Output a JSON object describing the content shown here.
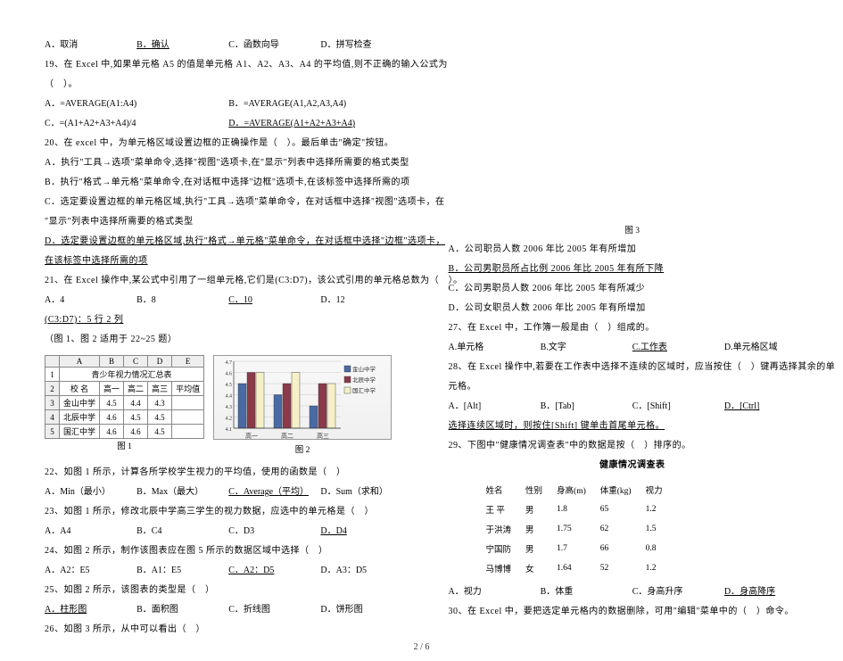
{
  "left": {
    "q18": {
      "a": "A．取消",
      "b": "B．确认",
      "c": "C．函数向导",
      "d": "D．拼写检查"
    },
    "q19": {
      "stem": "19、在 Excel 中,如果单元格 A5 的值是单元格 A1、A2、A3、A4 的平均值,则不正确的输入公式为",
      "stem2": "（　）。",
      "a": "A．=AVERAGE(A1:A4)",
      "b": "B．=AVERAGE(A1,A2,A3,A4)",
      "c": "C．=(A1+A2+A3+A4)/4",
      "d": "D．=AVERAGE(A1+A2+A3+A4)"
    },
    "q20": {
      "stem": "20、在 excel 中，为单元格区域设置边框的正确操作是（　）。最后单击\"确定\"按钮。",
      "a": "A．执行\"工具→选项\"菜单命令,选择\"视图\"选项卡,在\"显示\"列表中选择所需要的格式类型",
      "b": "B．执行\"格式→单元格\"菜单命令,在对话框中选择\"边框\"选项卡,在该标签中选择所需的项",
      "c": "C．选定要设置边框的单元格区域,执行\"工具→选项\"菜单命令，在对话框中选择\"视图\"选项卡，在",
      "c2": "\"显示\"列表中选择所需要的格式类型",
      "d": "D．选定要设置边框的单元格区域,执行\"格式→单元格\"菜单命令，在对话框中选择\"边框\"选项卡，",
      "d2": "在该标签中选择所需的项"
    },
    "q21": {
      "stem": "21、在 Excel 操作中,某公式中引用了一组单元格,它们是(C3:D7)，该公式引用的单元格总数为（　）。",
      "a": "A．4",
      "b": "B．8",
      "c": "C．10",
      "d": "D．12",
      "note": "(C3:D7)：5 行 2 列"
    },
    "figs_note": "（图 1、图 2 适用于 22~25 题）",
    "table": {
      "cols": [
        "",
        "A",
        "B",
        "C",
        "D",
        "E"
      ],
      "title": "青少年视力情况汇总表",
      "header": [
        "校 名",
        "高一",
        "高二",
        "高三",
        "平均值"
      ],
      "rows": [
        [
          "金山中学",
          "4.5",
          "4.4",
          "4.3",
          ""
        ],
        [
          "北辰中学",
          "4.6",
          "4.5",
          "4.5",
          ""
        ],
        [
          "国汇中学",
          "4.6",
          "4.6",
          "4.5",
          ""
        ]
      ]
    },
    "chart_data": {
      "type": "bar",
      "categories": [
        "高一",
        "高二",
        "高三"
      ],
      "series": [
        {
          "name": "金山中学",
          "values": [
            4.5,
            4.4,
            4.3
          ],
          "color": "#4a6aa5"
        },
        {
          "name": "北辰中学",
          "values": [
            4.6,
            4.5,
            4.5
          ],
          "color": "#8b3a4a"
        },
        {
          "name": "国汇中学",
          "values": [
            4.6,
            4.6,
            4.5
          ],
          "color": "#f5f0c8"
        }
      ],
      "ylim": [
        4.1,
        4.7
      ],
      "ticks": [
        4.1,
        4.2,
        4.3,
        4.4,
        4.5,
        4.6,
        4.7
      ]
    },
    "fig1": "图 1",
    "fig2": "图 2",
    "q22": {
      "stem": "22、如图 1 所示，计算各所学校学生视力的平均值，使用的函数是（　）",
      "a": "A．Min（最小）",
      "b": "B．Max（最大）",
      "c": "C．Average（平均）",
      "d": "D．Sum（求和）"
    },
    "q23": {
      "stem": "23、如图 1 所示，修改北辰中学高三学生的视力数据，应选中的单元格是（　）",
      "a": "A．A4",
      "b": "B．C4",
      "c": "C．D3",
      "d": "D．D4"
    },
    "q24": {
      "stem": "24、如图 2 所示，制作该图表应在图 5 所示的数据区域中选择（　）",
      "a": "A．A2：E5",
      "b": "B．A1：E5",
      "c": "C．A2：D5",
      "d": "D．A3：D5"
    },
    "q25": {
      "stem": "25、如图 2 所示，该图表的类型是（　）",
      "a": "A．柱形图",
      "b": "B．面积图",
      "c": "C．折线图",
      "d": "D．饼形图"
    },
    "q26": "26、如图 3 所示，从中可以看出（　）"
  },
  "right": {
    "fig3": "图 3",
    "q26opts": {
      "a": "A．公司职员人数 2006 年比 2005 年有所增加",
      "b": "B．公司男职员所占比例 2006 年比 2005 年有所下降",
      "c": "C．公司男职员人数 2006 年比 2005 年有所减少",
      "d": "D．公司女职员人数 2006 年比 2005 年有所增加"
    },
    "q27": {
      "stem": "27、在 Excel 中，工作簿一般是由（　）组成的。",
      "a": "A.单元格",
      "b": "B.文字",
      "c": "C.工作表",
      "d": "D.单元格区域"
    },
    "q28": {
      "stem": "28、在 Excel 操作中,若要在工作表中选择不连续的区域时，应当按住（　）键再选择其余的单",
      "stem2": "元格。",
      "a": "A．[Alt]",
      "b": "B．[Tab]",
      "c": "C．[Shift]",
      "d": "D．[Ctrl]",
      "note": "选择连续区域时，则按住[Shift] 键单击首尾单元格。"
    },
    "q29": {
      "stem": "29、下图中\"健康情况调查表\"中的数据是按（　）排序的。",
      "title": "健康情况调查表",
      "header": [
        "姓名",
        "性别",
        "身高(m)",
        "体重(kg)",
        "视力"
      ],
      "rows": [
        [
          "王 平",
          "男",
          "1.8",
          "65",
          "1.2"
        ],
        [
          "于洪涛",
          "男",
          "1.75",
          "62",
          "1.5"
        ],
        [
          "宁国防",
          "男",
          "1.7",
          "66",
          "0.8"
        ],
        [
          "马博博",
          "女",
          "1.64",
          "52",
          "1.2"
        ]
      ],
      "a": "A．视力",
      "b": "B．体重",
      "c": "C．身高升序",
      "d": "D．身高降序"
    },
    "q30": "30、在 Excel 中，要把选定单元格内的数据删除，可用\"编辑\"菜单中的（　）命令。"
  },
  "footer": "2 / 6"
}
